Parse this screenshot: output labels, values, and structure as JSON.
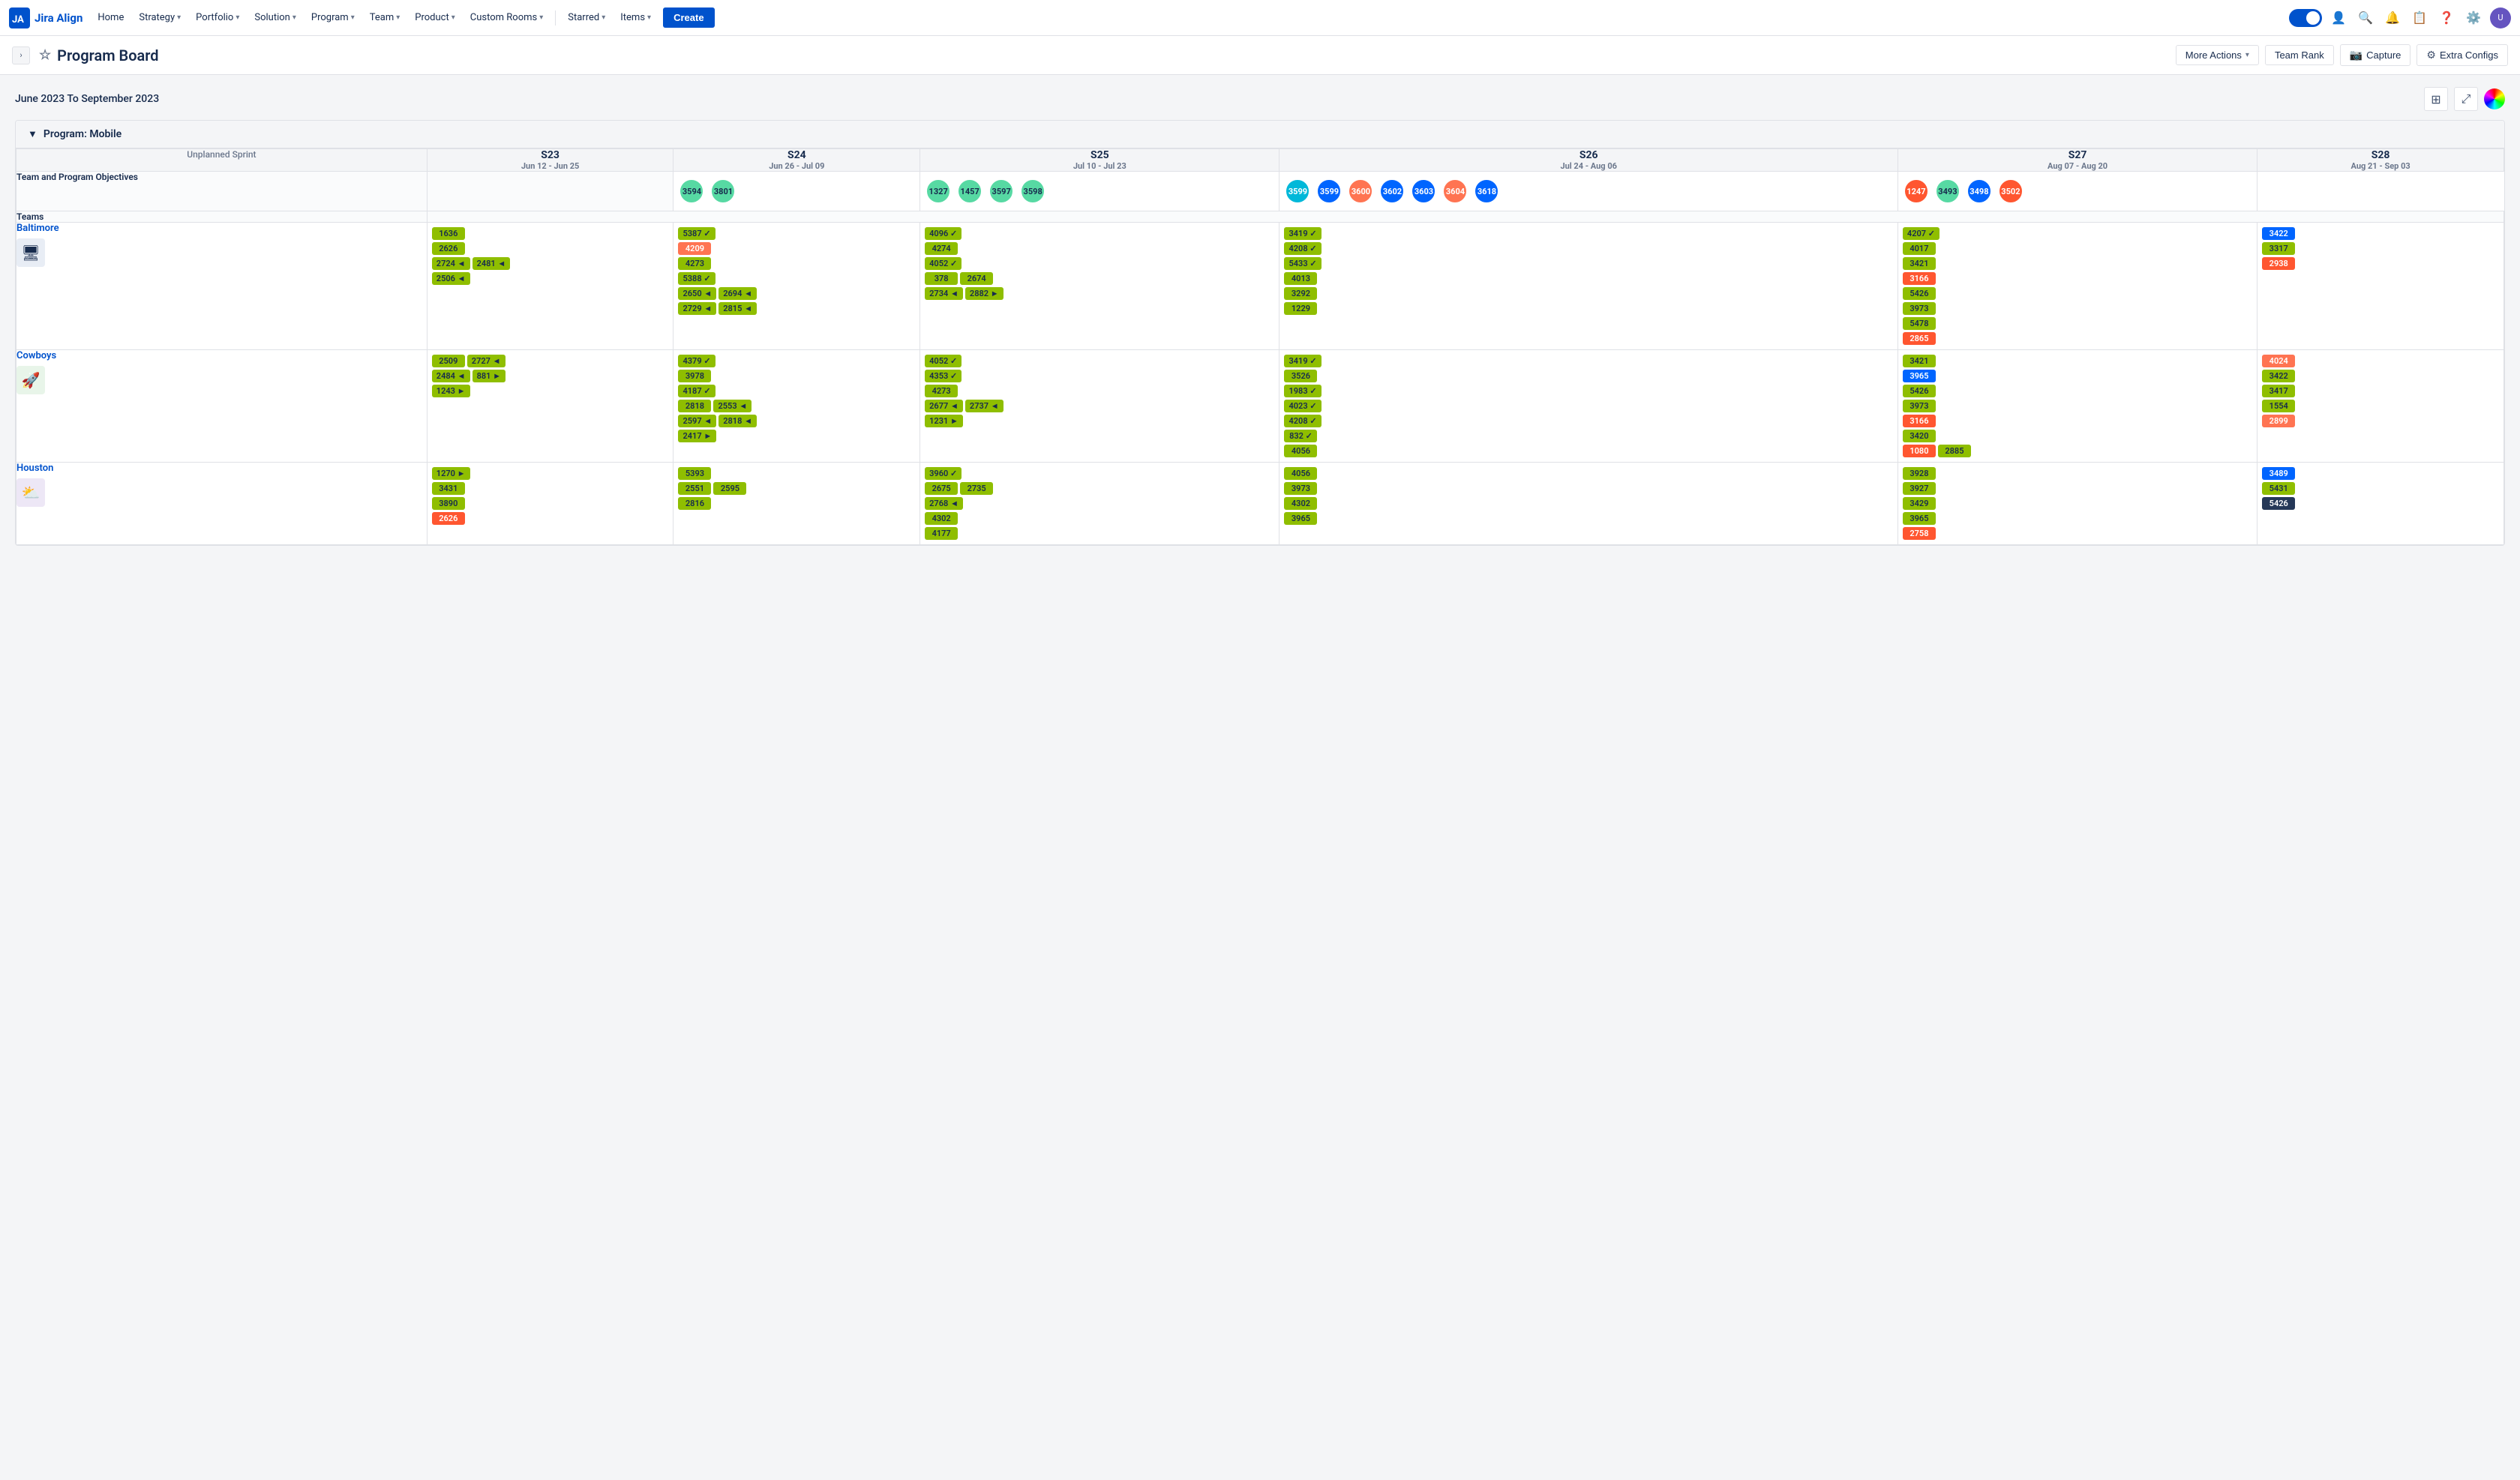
{
  "app": {
    "name": "Jira Align"
  },
  "nav": {
    "home": "Home",
    "strategy": "Strategy",
    "portfolio": "Portfolio",
    "solution": "Solution",
    "program": "Program",
    "team": "Team",
    "product": "Product",
    "custom_rooms": "Custom Rooms",
    "starred": "Starred",
    "items": "Items",
    "create": "Create"
  },
  "header": {
    "title": "Program Board",
    "more_actions": "More Actions",
    "team_rank": "Team Rank",
    "capture": "Capture",
    "extra_configs": "Extra Configs"
  },
  "board": {
    "date_range": "June 2023 To September 2023",
    "program_label": "Program: Mobile",
    "sprints": [
      {
        "name": "S23",
        "dates": "Jun 12 - Jun 25"
      },
      {
        "name": "S24",
        "dates": "Jun 26 - Jul 09"
      },
      {
        "name": "S25",
        "dates": "Jul 10 - Jul 23"
      },
      {
        "name": "S26",
        "dates": "Jul 24 - Aug 06"
      },
      {
        "name": "S27",
        "dates": "Aug 07 - Aug 20"
      },
      {
        "name": "S28",
        "dates": "Aug 21 - Sep 03"
      }
    ],
    "unplanned_sprint": "Unplanned Sprint",
    "team_and_program_objectives": "Team and Program Objectives",
    "teams_label": "Teams",
    "teams": [
      {
        "name": "Baltimore",
        "avatar_emoji": "🖥",
        "avatar_class": "team-avatar-baltimore",
        "rows": {
          "s23": [
            [
              {
                "id": "1636",
                "color": "card-lime"
              }
            ],
            [
              {
                "id": "2626",
                "color": "card-lime"
              }
            ],
            [
              {
                "id": "2724",
                "color": "card-lime",
                "indicator": "◄"
              },
              {
                "id": "2481",
                "color": "card-lime",
                "indicator": "◄"
              }
            ],
            [
              {
                "id": "2506",
                "color": "card-lime",
                "indicator": "◄"
              }
            ]
          ],
          "s24": [
            [
              {
                "id": "5387",
                "color": "card-lime",
                "indicator": "✓"
              }
            ],
            [
              {
                "id": "4209",
                "color": "card-orange"
              }
            ],
            [
              {
                "id": "4273",
                "color": "card-lime"
              }
            ],
            [
              {
                "id": "5388",
                "color": "card-lime",
                "indicator": "✓"
              }
            ],
            [
              {
                "id": "2650",
                "color": "card-lime",
                "indicator": "◄"
              },
              {
                "id": "2694",
                "color": "card-lime",
                "indicator": "◄"
              }
            ],
            [
              {
                "id": "2729",
                "color": "card-lime",
                "indicator": "◄"
              },
              {
                "id": "2815",
                "color": "card-lime",
                "indicator": "◄"
              }
            ]
          ],
          "s25": [
            [
              {
                "id": "4096",
                "color": "card-lime",
                "indicator": "✓"
              }
            ],
            [
              {
                "id": "4274",
                "color": "card-lime"
              }
            ],
            [
              {
                "id": "4052",
                "color": "card-lime",
                "indicator": "✓"
              }
            ],
            [
              {
                "id": "378",
                "color": "card-lime"
              },
              {
                "id": "2674",
                "color": "card-lime"
              }
            ],
            [
              {
                "id": "2734",
                "color": "card-lime",
                "indicator": "◄"
              },
              {
                "id": "2882",
                "color": "card-lime",
                "indicator": "►"
              }
            ]
          ],
          "s26": [
            [
              {
                "id": "3419",
                "color": "card-lime",
                "indicator": "✓"
              }
            ],
            [
              {
                "id": "4208",
                "color": "card-lime",
                "indicator": "✓"
              }
            ],
            [
              {
                "id": "5433",
                "color": "card-lime",
                "indicator": "✓"
              }
            ],
            [
              {
                "id": "4013",
                "color": "card-lime"
              }
            ],
            [
              {
                "id": "3292",
                "color": "card-lime"
              }
            ],
            [
              {
                "id": "1229",
                "color": "card-lime"
              }
            ]
          ],
          "s27": [
            [
              {
                "id": "4207",
                "color": "card-lime",
                "indicator": "✓"
              }
            ],
            [
              {
                "id": "4017",
                "color": "card-lime"
              }
            ],
            [
              {
                "id": "3421",
                "color": "card-lime"
              }
            ],
            [
              {
                "id": "3166",
                "color": "card-red"
              }
            ],
            [
              {
                "id": "5426",
                "color": "card-lime"
              }
            ],
            [
              {
                "id": "3973",
                "color": "card-lime"
              }
            ],
            [
              {
                "id": "5478",
                "color": "card-lime"
              }
            ],
            [
              {
                "id": "2865",
                "color": "card-red"
              }
            ]
          ],
          "s28": [
            [
              {
                "id": "3422",
                "color": "card-blue"
              }
            ],
            [
              {
                "id": "3317",
                "color": "card-lime"
              }
            ],
            [
              {
                "id": "2938",
                "color": "card-red"
              }
            ]
          ]
        }
      },
      {
        "name": "Cowboys",
        "avatar_emoji": "🚀",
        "avatar_class": "team-avatar-cowboys",
        "rows": {
          "s23": [
            [
              {
                "id": "2509",
                "color": "card-lime"
              },
              {
                "id": "2727",
                "color": "card-lime",
                "indicator": "◄"
              }
            ],
            [
              {
                "id": "2484",
                "color": "card-lime",
                "indicator": "◄"
              },
              {
                "id": "881",
                "color": "card-lime",
                "indicator": "►"
              }
            ],
            [
              {
                "id": "1243",
                "color": "card-lime",
                "indicator": "►"
              }
            ]
          ],
          "s24": [
            [
              {
                "id": "4379",
                "color": "card-lime",
                "indicator": "✓"
              }
            ],
            [
              {
                "id": "3978",
                "color": "card-lime"
              }
            ],
            [
              {
                "id": "4187",
                "color": "card-lime",
                "indicator": "✓"
              }
            ],
            [
              {
                "id": "2818",
                "color": "card-lime"
              },
              {
                "id": "2553",
                "color": "card-lime",
                "indicator": "◄"
              }
            ],
            [
              {
                "id": "2597",
                "color": "card-lime",
                "indicator": "◄"
              },
              {
                "id": "2818",
                "color": "card-lime",
                "indicator": "◄"
              }
            ],
            [
              {
                "id": "2417",
                "color": "card-lime",
                "indicator": "►"
              }
            ]
          ],
          "s25": [
            [
              {
                "id": "4052",
                "color": "card-lime",
                "indicator": "✓"
              }
            ],
            [
              {
                "id": "4353",
                "color": "card-lime",
                "indicator": "✓"
              }
            ],
            [
              {
                "id": "4273",
                "color": "card-lime"
              }
            ],
            [
              {
                "id": "2677",
                "color": "card-lime",
                "indicator": "◄"
              },
              {
                "id": "2737",
                "color": "card-lime",
                "indicator": "◄"
              }
            ],
            [
              {
                "id": "1231",
                "color": "card-lime",
                "indicator": "►"
              }
            ]
          ],
          "s26": [
            [
              {
                "id": "3419",
                "color": "card-lime",
                "indicator": "✓"
              }
            ],
            [
              {
                "id": "3526",
                "color": "card-lime"
              }
            ],
            [
              {
                "id": "1983",
                "color": "card-lime",
                "indicator": "✓"
              }
            ],
            [
              {
                "id": "4023",
                "color": "card-lime",
                "indicator": "✓"
              }
            ],
            [
              {
                "id": "4208",
                "color": "card-lime",
                "indicator": "✓"
              }
            ],
            [
              {
                "id": "832",
                "color": "card-lime",
                "indicator": "✓"
              }
            ],
            [
              {
                "id": "4056",
                "color": "card-lime"
              }
            ]
          ],
          "s27": [
            [
              {
                "id": "3421",
                "color": "card-lime"
              }
            ],
            [
              {
                "id": "3965",
                "color": "card-blue"
              }
            ],
            [
              {
                "id": "5426",
                "color": "card-lime"
              }
            ],
            [
              {
                "id": "3973",
                "color": "card-lime"
              }
            ],
            [
              {
                "id": "3166",
                "color": "card-red"
              }
            ],
            [
              {
                "id": "3420",
                "color": "card-lime"
              }
            ],
            [
              {
                "id": "1080",
                "color": "card-red"
              },
              {
                "id": "2885",
                "color": "card-lime"
              }
            ]
          ],
          "s28": [
            [
              {
                "id": "4024",
                "color": "card-orange"
              }
            ],
            [
              {
                "id": "3422",
                "color": "card-lime"
              }
            ],
            [
              {
                "id": "3417",
                "color": "card-lime"
              }
            ],
            [
              {
                "id": "1554",
                "color": "card-lime"
              }
            ],
            [
              {
                "id": "2899",
                "color": "card-orange"
              }
            ]
          ]
        }
      },
      {
        "name": "Houston",
        "avatar_emoji": "⛅",
        "avatar_class": "team-avatar-houston",
        "rows": {
          "s23": [
            [
              {
                "id": "1270",
                "color": "card-lime",
                "indicator": "►"
              }
            ],
            [
              {
                "id": "3431",
                "color": "card-lime"
              }
            ],
            [
              {
                "id": "3890",
                "color": "card-lime"
              }
            ],
            [
              {
                "id": "2626",
                "color": "card-red",
                "indicator": ""
              }
            ]
          ],
          "s24": [
            [
              {
                "id": "5393",
                "color": "card-lime"
              }
            ],
            [
              {
                "id": "2551",
                "color": "card-lime"
              },
              {
                "id": "2595",
                "color": "card-lime"
              }
            ],
            [
              {
                "id": "2816",
                "color": "card-lime"
              }
            ]
          ],
          "s25": [
            [
              {
                "id": "3960",
                "color": "card-lime",
                "indicator": "✓"
              }
            ],
            [
              {
                "id": "2675",
                "color": "card-lime"
              },
              {
                "id": "2735",
                "color": "card-lime"
              }
            ],
            [
              {
                "id": "2768",
                "color": "card-lime",
                "indicator": "◄"
              }
            ],
            [
              {
                "id": "4302",
                "color": "card-lime"
              }
            ],
            [
              {
                "id": "4177",
                "color": "card-lime"
              }
            ]
          ],
          "s26": [
            [
              {
                "id": "4056",
                "color": "card-lime"
              }
            ],
            [
              {
                "id": "3973",
                "color": "card-lime"
              }
            ],
            [
              {
                "id": "4302",
                "color": "card-lime"
              }
            ],
            [
              {
                "id": "3965",
                "color": "card-lime"
              }
            ]
          ],
          "s27": [
            [
              {
                "id": "3928",
                "color": "card-lime"
              }
            ],
            [
              {
                "id": "3927",
                "color": "card-lime"
              }
            ],
            [
              {
                "id": "3429",
                "color": "card-lime"
              }
            ],
            [
              {
                "id": "3965",
                "color": "card-lime"
              }
            ],
            [
              {
                "id": "2758",
                "color": "card-red"
              }
            ]
          ],
          "s28": [
            [
              {
                "id": "3489",
                "color": "card-blue"
              }
            ],
            [
              {
                "id": "5431",
                "color": "card-lime"
              }
            ],
            [
              {
                "id": "5426",
                "color": "card-dark"
              }
            ]
          ]
        }
      }
    ],
    "objectives": {
      "s23": [],
      "s24": [
        {
          "id": "3594",
          "color": "obj-green"
        },
        {
          "id": "3801",
          "color": "obj-green"
        }
      ],
      "s25": [
        {
          "id": "1327",
          "color": "obj-green"
        },
        {
          "id": "1457",
          "color": "obj-green"
        },
        {
          "id": "3597",
          "color": "obj-green"
        },
        {
          "id": "3598",
          "color": "obj-green"
        }
      ],
      "s26": [
        {
          "id": "3599",
          "color": "obj-teal"
        },
        {
          "id": "3599",
          "color": "obj-blue"
        },
        {
          "id": "3600",
          "color": "obj-orange"
        },
        {
          "id": "3602",
          "color": "obj-blue"
        },
        {
          "id": "3603",
          "color": "obj-blue"
        },
        {
          "id": "3604",
          "color": "obj-orange"
        },
        {
          "id": "3618",
          "color": "obj-blue"
        }
      ],
      "s27": [
        {
          "id": "1247",
          "color": "obj-red"
        },
        {
          "id": "3493",
          "color": "obj-green"
        },
        {
          "id": "3498",
          "color": "obj-blue"
        },
        {
          "id": "3502",
          "color": "obj-red"
        }
      ]
    }
  }
}
